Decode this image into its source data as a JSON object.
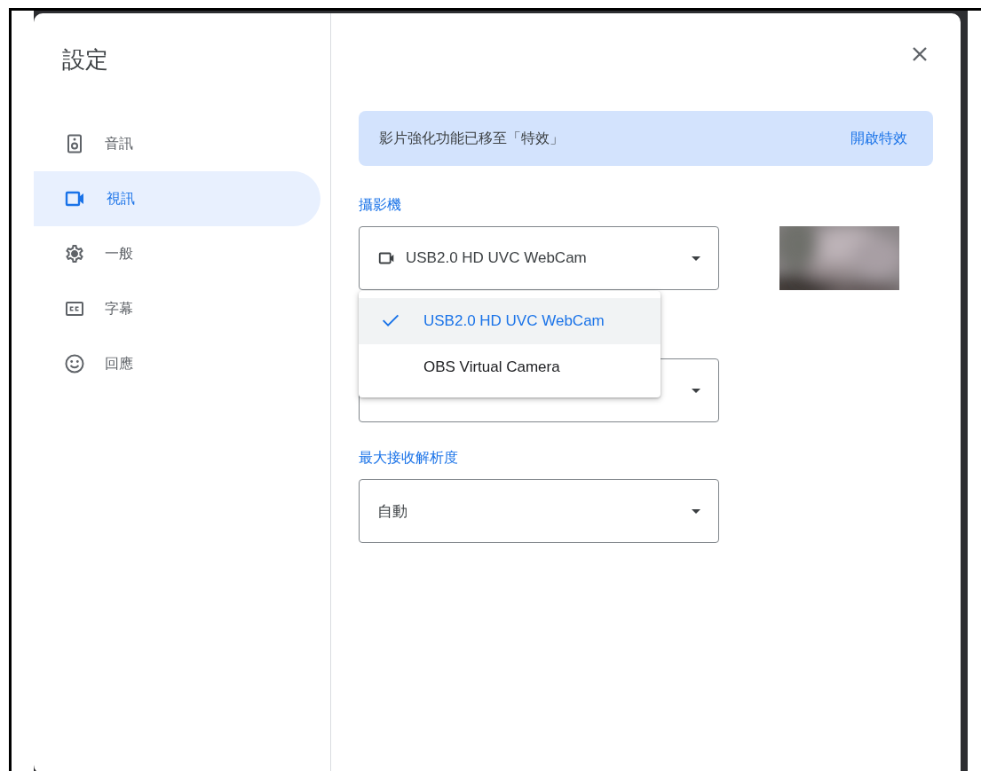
{
  "dialog": {
    "title": "設定"
  },
  "nav": [
    {
      "label": "音訊",
      "kind": "speaker",
      "selected": false
    },
    {
      "label": "視訊",
      "kind": "video",
      "selected": true
    },
    {
      "label": "一般",
      "kind": "gear",
      "selected": false
    },
    {
      "label": "字幕",
      "kind": "cc",
      "selected": false
    },
    {
      "label": "回應",
      "kind": "smile",
      "selected": false
    }
  ],
  "banner": {
    "text": "影片強化功能已移至「特效」",
    "action": "開啟特效"
  },
  "camera": {
    "label": "攝影機",
    "value": "USB2.0 HD UVC WebCam",
    "menu": [
      {
        "label": "USB2.0 HD UVC WebCam",
        "selected": true
      },
      {
        "label": "OBS Virtual Camera",
        "selected": false
      }
    ]
  },
  "receive_resolution": {
    "label": "最大接收解析度",
    "value": "自動"
  }
}
